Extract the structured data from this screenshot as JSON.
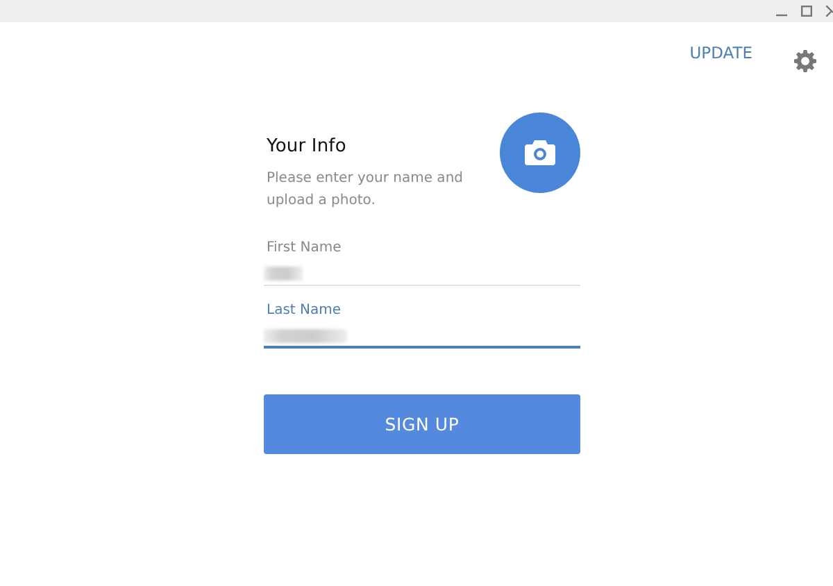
{
  "window": {
    "controls": [
      {
        "kind": "minimize"
      },
      {
        "kind": "maximize"
      },
      {
        "kind": "close"
      }
    ]
  },
  "header": {
    "update_link": "UPDATE"
  },
  "form": {
    "title": "Your Info",
    "description": "Please enter your name and upload a photo.",
    "fields": [
      {
        "label": "First Name",
        "focused": false,
        "value_blurred": true
      },
      {
        "label": "Last Name",
        "focused": true,
        "value_blurred": true
      }
    ],
    "submit": "SIGN UP"
  }
}
